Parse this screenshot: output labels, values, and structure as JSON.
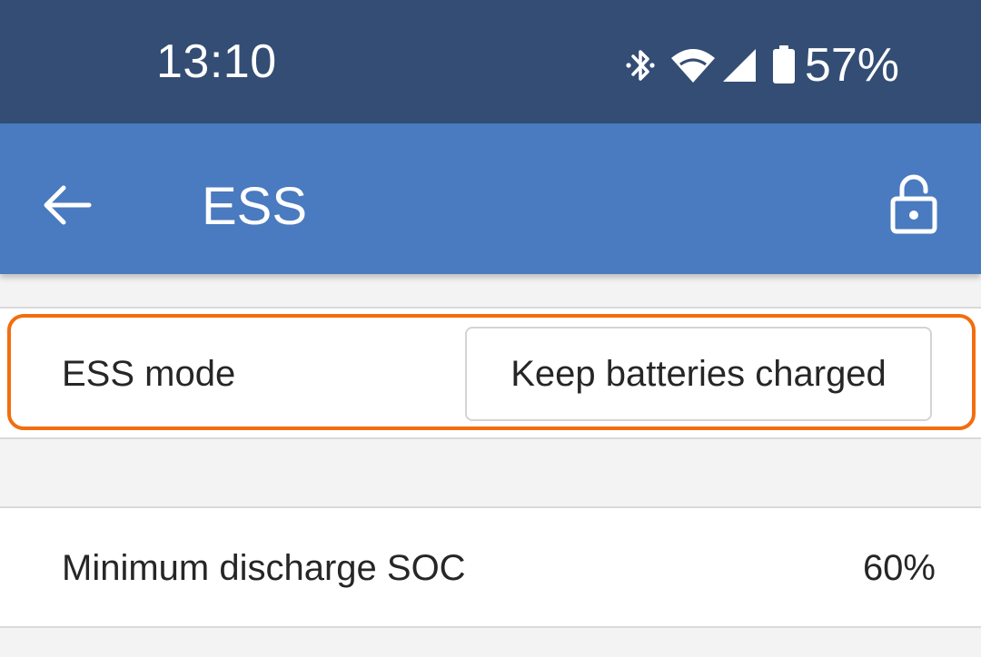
{
  "status_bar": {
    "time": "13:10",
    "battery_percent": "57%",
    "icons": [
      "bluetooth-icon",
      "wifi-icon",
      "cell-signal-icon",
      "battery-icon"
    ]
  },
  "app_bar": {
    "title": "ESS",
    "back_icon": "arrow-back-icon",
    "lock_icon": "lock-open-icon"
  },
  "settings": {
    "ess_mode": {
      "label": "ESS mode",
      "selected_value": "Keep batteries charged"
    },
    "min_discharge_soc": {
      "label": "Minimum discharge SOC",
      "value": "60%"
    }
  },
  "colors": {
    "status_bar_bg": "#334d75",
    "app_bar_bg": "#4a7abf",
    "highlight": "#f26d0f",
    "page_bg": "#f3f3f3"
  }
}
